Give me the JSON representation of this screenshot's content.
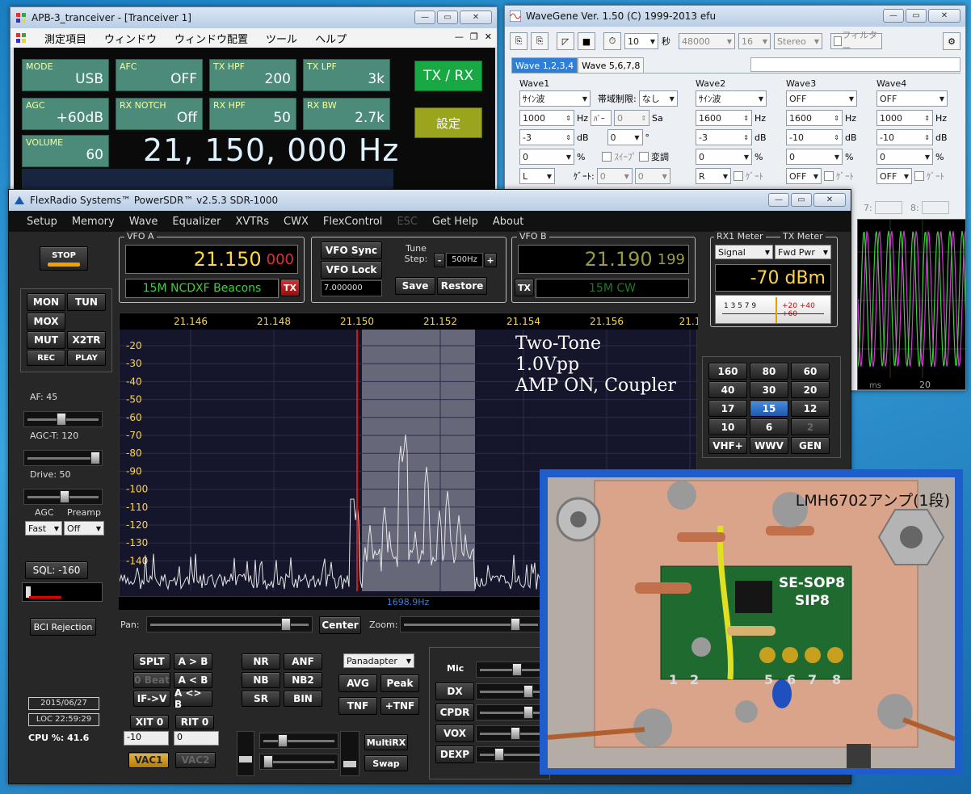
{
  "apb": {
    "title": "APB-3_tranceiver - [Tranceiver 1]",
    "menu": [
      "測定項目",
      "ウィンドウ",
      "ウィンドウ配置",
      "ツール",
      "ヘルプ"
    ],
    "cells": [
      {
        "label": "MODE",
        "value": "USB"
      },
      {
        "label": "AFC",
        "value": "OFF"
      },
      {
        "label": "TX HPF",
        "value": "200"
      },
      {
        "label": "TX LPF",
        "value": "3k"
      },
      {
        "label": "AGC",
        "value": "+60dB"
      },
      {
        "label": "RX NOTCH",
        "value": "Off"
      },
      {
        "label": "RX HPF",
        "value": "50"
      },
      {
        "label": "RX BW",
        "value": "2.7k"
      },
      {
        "label": "VOLUME",
        "value": "60"
      }
    ],
    "frequency": "21, 150, 000 Hz",
    "txrx_label": "TX / RX",
    "settings_label": "設定"
  },
  "wavegene": {
    "title": "WaveGene  Ver. 1.50  (C) 1999-2013 efu",
    "toolbar": {
      "duration": "10",
      "duration_unit": "秒",
      "rate": "48000",
      "bits": "16",
      "channels": "Stereo",
      "filter": "フィルター"
    },
    "tabs": [
      "Wave 1,2,3,4",
      "Wave 5,6,7,8"
    ],
    "waves": [
      {
        "header": "Wave1",
        "type": "ｻｲﾝ波",
        "freq": "1000",
        "freq_unit": "Hz",
        "level": "-3",
        "level_unit": "dB",
        "duty": "0",
        "duty_unit": "%",
        "channel": "L",
        "gate_label": "ｹﾞｰﾄ:",
        "band_label": "帯域制限:",
        "band": "なし",
        "bar_label": "ﾊﾞｰ",
        "bar_val": "0",
        "sa": "Sa",
        "phase": "0",
        "phase_unit": "°",
        "sweep": "ｽｲｰﾌﾟ",
        "mod": "変調",
        "gate1": "0",
        "gate2": "0"
      },
      {
        "header": "Wave2",
        "type": "ｻｲﾝ波",
        "freq": "1600",
        "freq_unit": "Hz",
        "level": "-3",
        "level_unit": "dB",
        "duty": "0",
        "duty_unit": "%",
        "channel": "R",
        "gate": "ｹﾞｰﾄ"
      },
      {
        "header": "Wave3",
        "type": "OFF",
        "freq": "1600",
        "freq_unit": "Hz",
        "level": "-10",
        "level_unit": "dB",
        "duty": "0",
        "duty_unit": "%",
        "channel": "OFF",
        "gate": "ｹﾞｰﾄ"
      },
      {
        "header": "Wave4",
        "type": "OFF",
        "freq": "1000",
        "freq_unit": "Hz",
        "level": "-10",
        "level_unit": "dB",
        "duty": "0",
        "duty_unit": "%",
        "channel": "OFF",
        "gate": "ｹﾞｰﾄ"
      }
    ],
    "status_slots": [
      "7:",
      "8:"
    ],
    "scope_label": "ms",
    "scope_tick": "20"
  },
  "psdr": {
    "title": "FlexRadio Systems™  PowerSDR™  v2.5.3   SDR-1000",
    "menu": [
      "Setup",
      "Memory",
      "Wave",
      "Equalizer",
      "XVTRs",
      "CWX",
      "FlexControl",
      "ESC",
      "Get Help",
      "About"
    ],
    "stop": "STOP",
    "left_buttons": [
      "MON",
      "TUN",
      "MOX",
      "MUT",
      "X2TR",
      "REC",
      "PLAY"
    ],
    "af_label": "AF:  45",
    "agct_label": "AGC-T:  120",
    "drive_label": "Drive:  50",
    "agc_label": "AGC",
    "preamp_label": "Preamp",
    "agc_value": "Fast",
    "preamp_value": "Off",
    "sql_label": "SQL: -160",
    "bci": "BCI Rejection",
    "date": "2015/06/27",
    "time": "LOC 22:59:29",
    "cpu": "CPU %: 41.6",
    "vfoa": {
      "title": "VFO A",
      "freq_main": "21.150",
      "freq_sub": "000",
      "band": "15M NCDXF Beacons",
      "tx": "TX"
    },
    "vfob": {
      "title": "VFO B",
      "freq_main": "21.190",
      "freq_sub": "199",
      "band": "15M CW",
      "tx": "TX"
    },
    "vfo_sync": "VFO Sync",
    "vfo_lock": "VFO Lock",
    "tune_step_label": "Tune Step:",
    "tune_step": "500Hz",
    "step_minus": "-",
    "step_plus": "+",
    "tune_value": "7.000000",
    "save": "Save",
    "restore": "Restore",
    "rx1meter_title": "RX1 Meter",
    "txmeter_title": "TX Meter",
    "rx1meter_sel": "Signal",
    "txmeter_sel": "Fwd Pwr",
    "meter_reading": "-70 dBm",
    "meter_scale": "1  3  5  7  9",
    "meter_scale_red": "+20  +40  +60",
    "freq_ticks": [
      "21.146",
      "21.148",
      "21.150",
      "21.152",
      "21.154",
      "21.156",
      "21.1"
    ],
    "db_ticks": [
      "-20",
      "-30",
      "-40",
      "-50",
      "-60",
      "-70",
      "-80",
      "-90",
      "-100",
      "-110",
      "-120",
      "-130",
      "-140"
    ],
    "annotation": [
      "Two-Tone",
      "1.0Vpp",
      "AMP ON, Coupler"
    ],
    "cursor_readout": "1698.9Hz",
    "bands": [
      "160",
      "80",
      "60",
      "40",
      "30",
      "20",
      "17",
      "15",
      "12",
      "10",
      "6",
      "2",
      "VHF+",
      "WWV",
      "GEN"
    ],
    "pan_label": "Pan:",
    "center": "Center",
    "zoom_label": "Zoom:",
    "bottom_left": [
      "SPLT",
      "A > B",
      "0 Beat",
      "A < B",
      "IF->V",
      "A <> B"
    ],
    "xit": "XIT  0",
    "rit": "RIT  0",
    "xit_val": "-10",
    "rit_val": "0",
    "vac1": "VAC1",
    "vac2": "VAC2",
    "dsp": [
      "NR",
      "ANF",
      "NB",
      "NB2",
      "SR",
      "BIN"
    ],
    "display_mode": "Panadapter",
    "avg": "AVG",
    "peak": "Peak",
    "tnf": "TNF",
    "ptnf": "+TNF",
    "multirx": "MultiRX",
    "swap": "Swap",
    "mic_label": "Mic",
    "tx_buttons": [
      "DX",
      "CPDR",
      "VOX",
      "DEXP"
    ]
  },
  "photo": {
    "caption": "LMH6702アンプ(1段)",
    "board_label_top": "SE-SOP8",
    "board_label_sub": "SIP8",
    "pin_labels": [
      "1",
      "2",
      "5",
      "6",
      "7",
      "8"
    ]
  }
}
